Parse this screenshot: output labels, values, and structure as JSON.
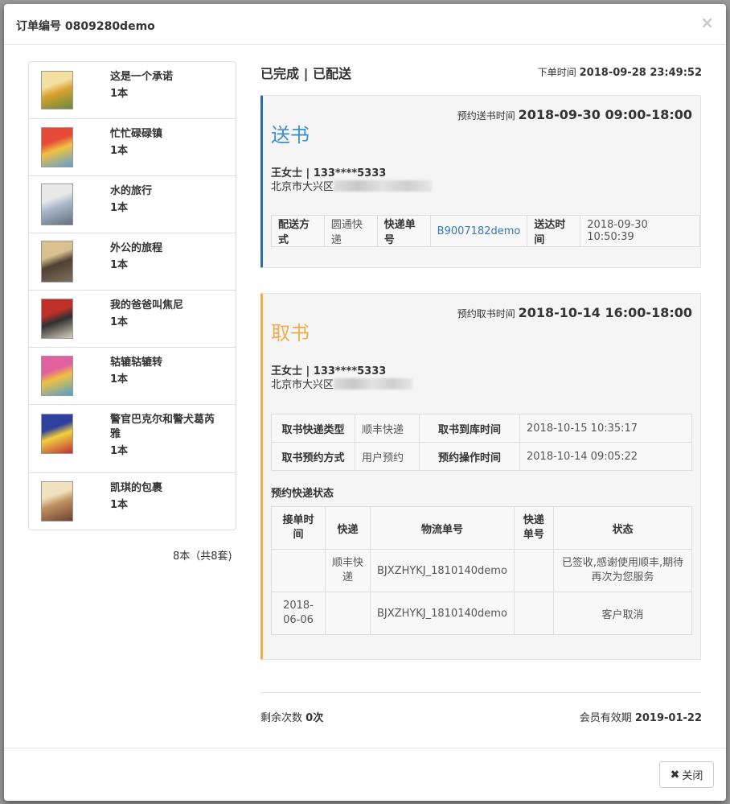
{
  "header": {
    "title": "订单编号 0809280demo",
    "close": "×"
  },
  "books": [
    {
      "title": "这是一个承诺",
      "qty": "1本",
      "cover": [
        "#f3e0a0",
        "#d9a030",
        "#6a8a3a"
      ]
    },
    {
      "title": "忙忙碌碌镇",
      "qty": "1本",
      "cover": [
        "#e84a3a",
        "#f2c040",
        "#5aa0d0"
      ]
    },
    {
      "title": "水的旅行",
      "qty": "1本",
      "cover": [
        "#e8e8e8",
        "#a8b8c8",
        "#607080"
      ]
    },
    {
      "title": "外公的旅程",
      "qty": "1本",
      "cover": [
        "#d8c090",
        "#504030",
        "#807060"
      ]
    },
    {
      "title": "我的爸爸叫焦尼",
      "qty": "1本",
      "cover": [
        "#c0302a",
        "#303030",
        "#d8d0c0"
      ]
    },
    {
      "title": "轱辘轱辘转",
      "qty": "1本",
      "cover": [
        "#e060a0",
        "#f0c040",
        "#50a0d0"
      ]
    },
    {
      "title": "警官巴克尔和警犬葛芮雅",
      "qty": "1本",
      "cover": [
        "#3040a0",
        "#f0d040",
        "#c03030"
      ]
    },
    {
      "title": "凯琪的包裹",
      "qty": "1本",
      "cover": [
        "#f0e0c0",
        "#c09060",
        "#704030"
      ]
    }
  ],
  "books_total": "8本（共8套)",
  "status": "已完成 | 已配送",
  "order_time": {
    "label": "下单时间",
    "value": "2018-09-28 23:49:52"
  },
  "delivery": {
    "time_label": "预约送书时间",
    "time_value": "2018-09-30 09:00-18:00",
    "title": "送书",
    "person": "王女士 | 133****5333",
    "address": "北京市大兴区",
    "table": {
      "method_label": "配送方式",
      "method": "圆通快递",
      "tracking_label": "快递单号",
      "tracking": "B9007182demo",
      "arrive_label": "送达时间",
      "arrive": "2018-09-30 10:50:39"
    }
  },
  "pickup": {
    "time_label": "预约取书时间",
    "time_value": "2018-10-14 16:00-18:00",
    "title": "取书",
    "person": "王女士 | 133****5333",
    "address": "北京市大兴区",
    "info": {
      "type_label": "取书快递类型",
      "type": "顺丰快递",
      "storage_label": "取书到库时间",
      "storage": "2018-10-15 10:35:17",
      "method_label": "取书预约方式",
      "method": "用户预约",
      "op_label": "预约操作时间",
      "op": "2018-10-14 09:05:22"
    },
    "status_title": "预约快递状态",
    "columns": [
      "接单时间",
      "快递",
      "物流单号",
      "快递单号",
      "状态"
    ],
    "rows": [
      {
        "time": "",
        "express": "顺丰快递",
        "logistics": "BJXZHYKJ_1810140demo",
        "tracking": "",
        "state": "已签收,感谢使用顺丰,期待再次为您服务"
      },
      {
        "time": "2018-06-06",
        "express": "",
        "logistics": "BJXZHYKJ_1810140demo",
        "tracking": "",
        "state": "客户取消"
      }
    ]
  },
  "remaining": {
    "label": "剩余次数",
    "value": "0次"
  },
  "membership": {
    "label": "会员有效期",
    "value": "2019-01-22"
  },
  "footer": {
    "close_label": "关闭",
    "close_icon": "✖"
  }
}
